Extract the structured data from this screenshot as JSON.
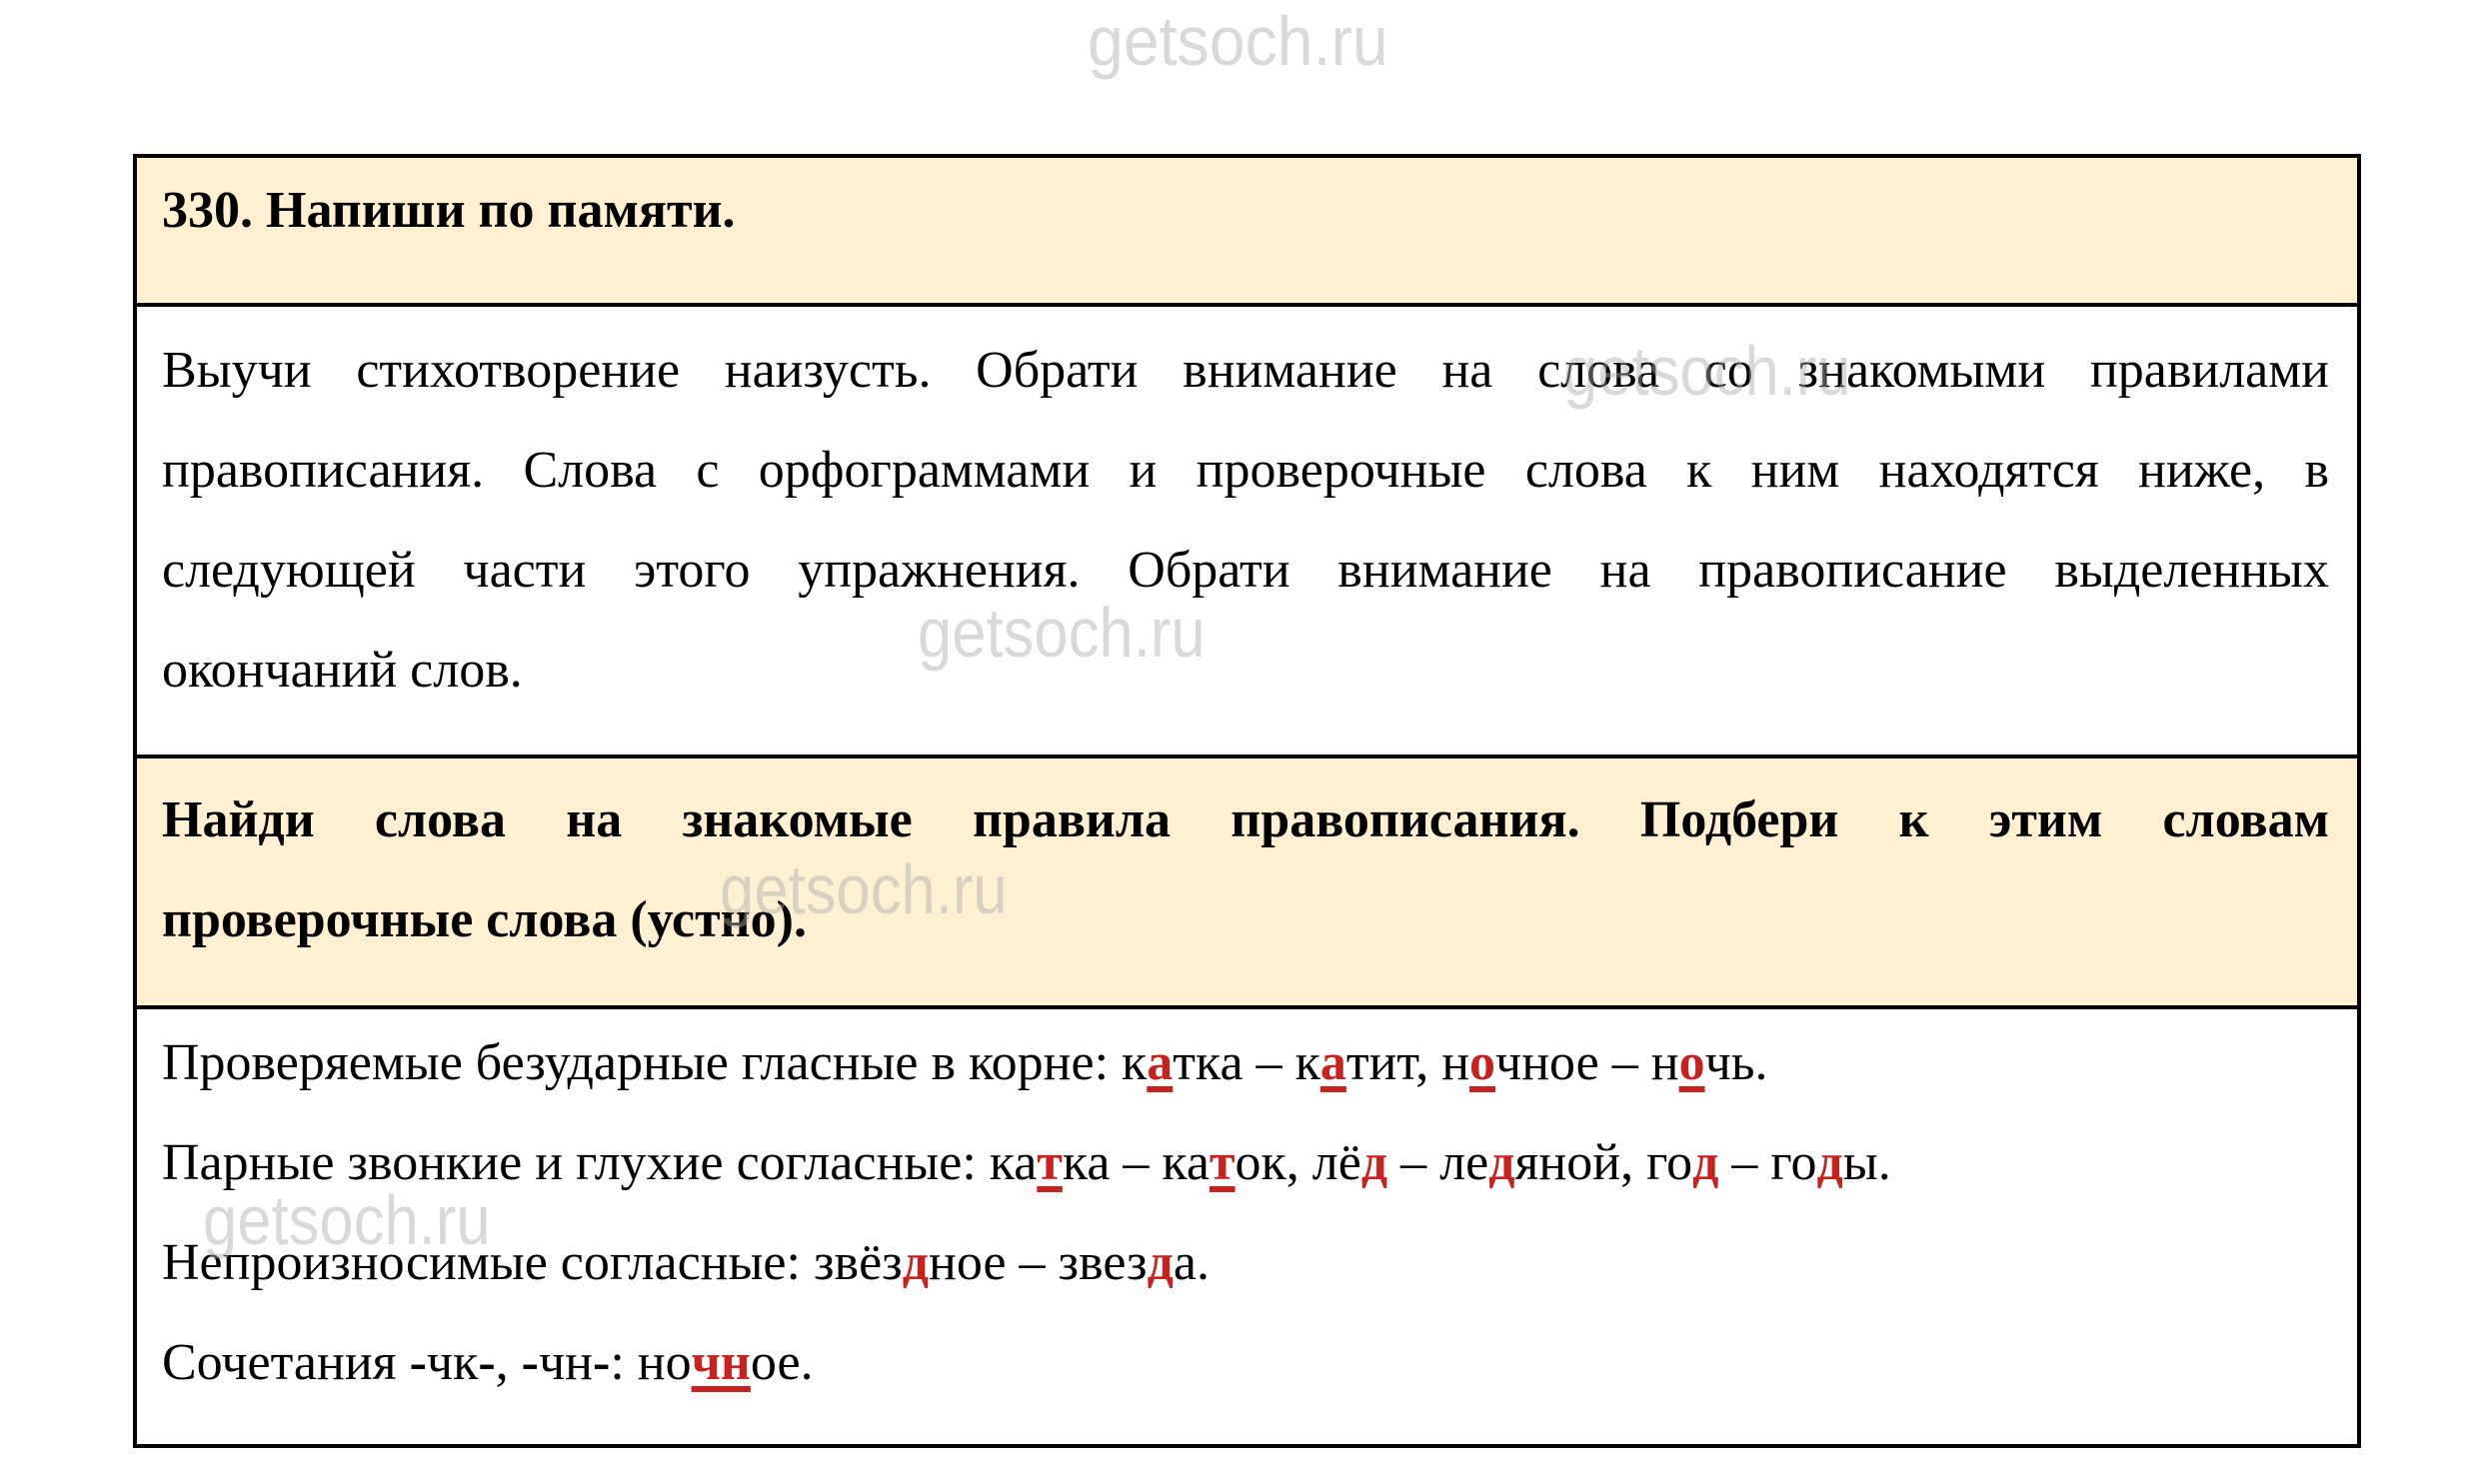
{
  "watermark": "getsoch.ru",
  "colors": {
    "header_fill": "#fff0d2",
    "border": "#000000",
    "highlight": "#c9211e",
    "watermark": "#d9d9d9"
  },
  "task": {
    "title": "330. Напиши по памяти.",
    "instruction_lines": [
      "Выучи стихотворение наизусть. Обрати внимание на слова со знакомыми правилами",
      "правописания. Слова с орфограммами и проверочные слова к ним находятся ниже, в",
      "следующей части этого упражнения. Обрати внимание на правописание выделенных",
      "окончаний слов."
    ],
    "subtask_lines": [
      "Найди слова на знакомые правила правописания. Подбери к этим словам",
      "проверочные слова (устно)."
    ]
  },
  "answers": [
    {
      "label": "Проверяемые безударные гласные в корне: ",
      "parts": [
        {
          "t": "к"
        },
        {
          "t": "а",
          "hl": true
        },
        {
          "t": "тка – к"
        },
        {
          "t": "а",
          "hl": true
        },
        {
          "t": "тит, н"
        },
        {
          "t": "о",
          "hl": true
        },
        {
          "t": "чное – н"
        },
        {
          "t": "о",
          "hl": true
        },
        {
          "t": "чь."
        }
      ]
    },
    {
      "label": "Парные звонкие и глухие согласные: ",
      "parts": [
        {
          "t": "ка"
        },
        {
          "t": "т",
          "hl": true
        },
        {
          "t": "ка – ка"
        },
        {
          "t": "т",
          "hl": true
        },
        {
          "t": "ок, лё"
        },
        {
          "t": "д",
          "hl": true
        },
        {
          "t": " – ле"
        },
        {
          "t": "д",
          "hl": true
        },
        {
          "t": "яной, го"
        },
        {
          "t": "д",
          "hl": true
        },
        {
          "t": " – го"
        },
        {
          "t": "д",
          "hl": true
        },
        {
          "t": "ы."
        }
      ]
    },
    {
      "label": "Непроизносимые согласные: ",
      "parts": [
        {
          "t": "звёз"
        },
        {
          "t": "д",
          "hl": true
        },
        {
          "t": "ное – звез"
        },
        {
          "t": "д",
          "hl": true
        },
        {
          "t": "а."
        }
      ]
    },
    {
      "label": "Сочетания ",
      "parts": [
        {
          "t": "-",
          "b": true
        },
        {
          "t": "чк"
        },
        {
          "t": "-",
          "b": true
        },
        {
          "t": ", "
        },
        {
          "t": "-",
          "b": true
        },
        {
          "t": "чн"
        },
        {
          "t": "-",
          "b": true
        },
        {
          "t": ": но"
        },
        {
          "t": "чн",
          "hl": true
        },
        {
          "t": "ое."
        }
      ]
    }
  ]
}
